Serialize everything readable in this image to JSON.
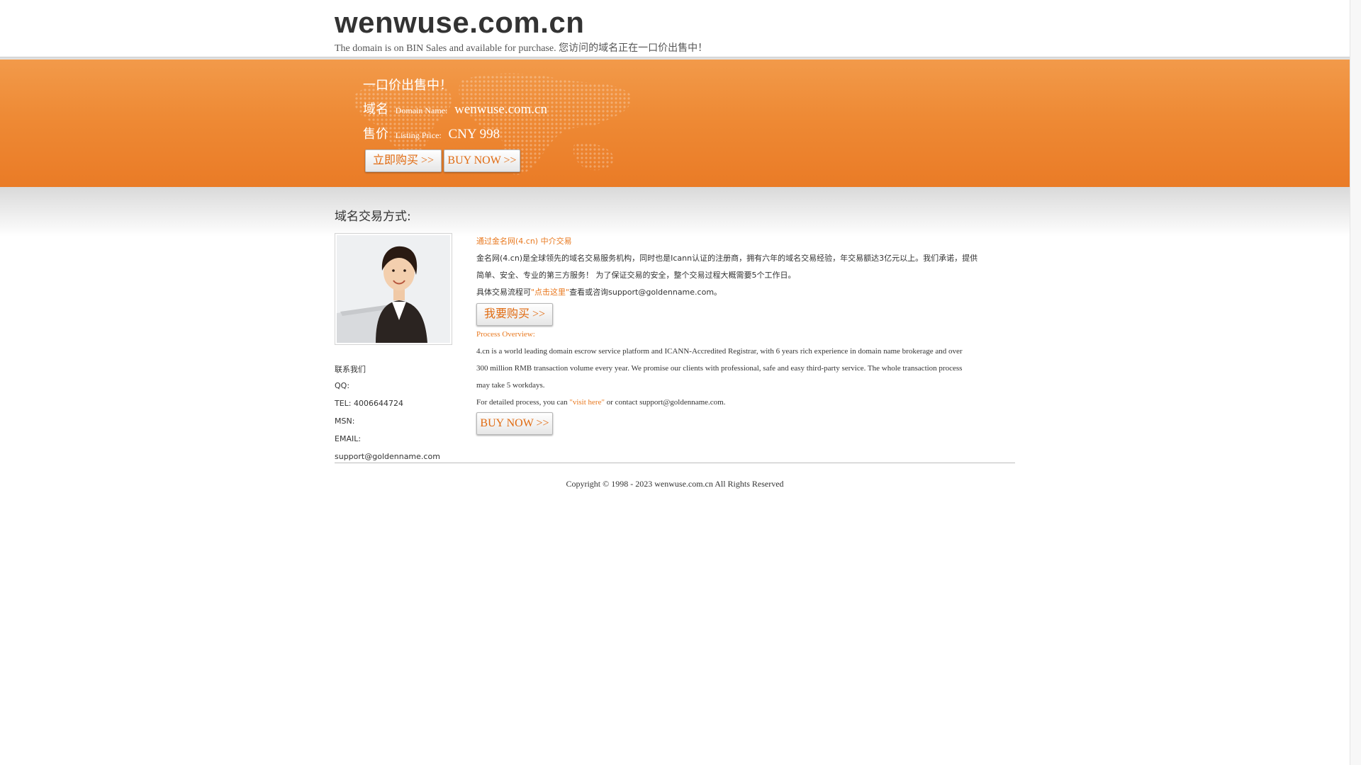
{
  "header": {
    "site_title": "wenwuse.com.cn",
    "subtitle": "The domain is on BIN Sales and available for purchase. 您访问的域名正在一口价出售中！"
  },
  "banner": {
    "headline": "一口价出售中！",
    "domain_label_cn": "域名",
    "domain_label_en": "Domain Name:",
    "domain_value": "wenwuse.com.cn",
    "price_label_cn": "售价",
    "price_label_en": "Listing Price:",
    "price_value": "CNY 998",
    "buy_cn_button": "立即购买 >>",
    "buy_en_button": "BUY NOW >>"
  },
  "section": {
    "title": "域名交易方式:"
  },
  "contact": {
    "heading": "联系我们",
    "qq": "QQ:",
    "tel": "TEL:  4006644724",
    "msn": "MSN:",
    "email_label": "EMAIL:",
    "email_value": "support@goldenname.com"
  },
  "main": {
    "heading_cn": "通过金名网(4.cn) 中介交易",
    "para_cn_line1": "金名网(4.cn)是全球领先的域名交易服务机构，同时也是Icann认证的注册商，拥有六年的域名交易经验，年交易额达3亿元以上。我们承诺，提供",
    "para_cn_line2": "简单、安全、专业的第三方服务！ 为了保证交易的安全，整个交易过程大概需要5个工作日。",
    "detail_cn_prefix": "具体交易流程可",
    "detail_cn_link": "\"点击这里\"",
    "detail_cn_suffix": "查看或咨询support@goldenname.com。",
    "want_buy_button": "我要购买 >>",
    "process_title": "Process Overview:",
    "para_en_line1": "4.cn is a world leading domain escrow service platform and ICANN-Accredited Registrar, with 6 years rich experience in domain name brokerage and over",
    "para_en_line2": "300 million RMB transaction volume every year. We promise our clients with professional, safe and easy third-party service. The whole transaction process",
    "para_en_line3": "may take 5 workdays.",
    "detail_en_prefix": "For detailed process, you can ",
    "detail_en_link": "\"visit here\"",
    "detail_en_suffix": " or contact support@goldenname.com.",
    "buy_now_button": "BUY NOW >>"
  },
  "footer": {
    "copyright": "Copyright © 1998 - 2023 wenwuse.com.cn All Rights Reserved"
  },
  "colors": {
    "accent_orange": "#ee8a35",
    "link_orange": "#e8781e",
    "text": "#333333"
  }
}
